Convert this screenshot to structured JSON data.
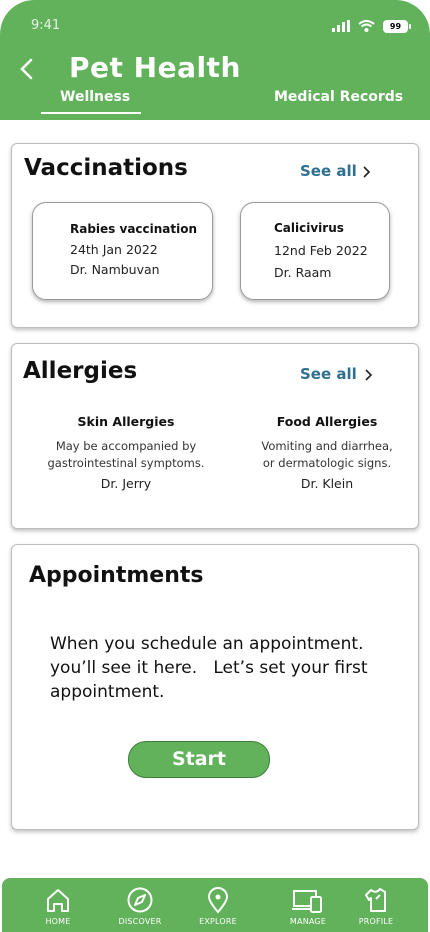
{
  "status": {
    "time": "9:41",
    "battery": "99"
  },
  "header": {
    "title": "Pet Health"
  },
  "tabs": [
    {
      "label": "Wellness",
      "active": true
    },
    {
      "label": "Medical Records",
      "active": false
    }
  ],
  "vaccinations": {
    "title": "Vaccinations",
    "see_all": "See all",
    "items": [
      {
        "name": "Rabies vaccination",
        "date": "24th Jan 2022",
        "doctor": "Dr. Nambuvan"
      },
      {
        "name": "Calicivirus",
        "date": "12nd Feb 2022",
        "doctor": "Dr. Raam"
      }
    ]
  },
  "allergies": {
    "title": "Allergies",
    "see_all": "See all",
    "items": [
      {
        "name": "Skin Allergies",
        "desc1": "May be accompanied by",
        "desc2": "gastrointestinal symptoms.",
        "doctor": "Dr. Jerry"
      },
      {
        "name": "Food Allergies",
        "desc1": "Vomiting and diarrhea,",
        "desc2": "or dermatologic signs.",
        "doctor": "Dr. Klein"
      }
    ]
  },
  "appointments": {
    "title": "Appointments",
    "line1": "When you schedule an appointment.",
    "line2": "you’ll see it here.   Let’s set your first",
    "line3": "appointment.",
    "button": "Start"
  },
  "nav": [
    {
      "label": "HOME",
      "icon": "home-icon"
    },
    {
      "label": "DISCOVER",
      "icon": "compass-icon"
    },
    {
      "label": "EXPLORE",
      "icon": "location-pin-icon"
    },
    {
      "label": "MANAGE",
      "icon": "devices-icon"
    },
    {
      "label": "PROFILE",
      "icon": "shirt-icon"
    }
  ],
  "colors": {
    "brand_green": "#62b15b",
    "link_blue": "#2f6f8f"
  }
}
